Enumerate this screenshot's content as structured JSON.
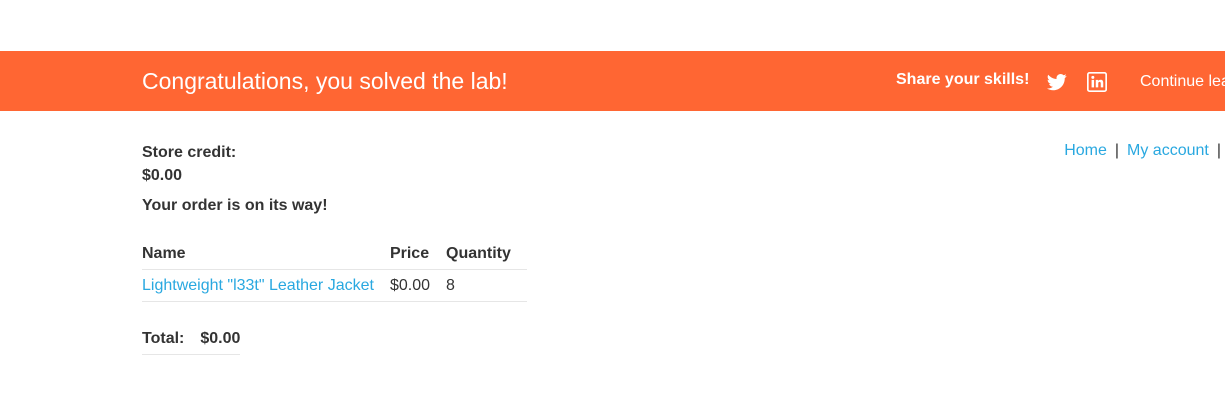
{
  "banner": {
    "title": "Congratulations, you solved the lab!",
    "share_label": "Share your skills!",
    "twitter_icon": "twitter-icon",
    "linkedin_icon": "linkedin-icon",
    "continue_label": "Continue learning",
    "background_color": "#ff6633"
  },
  "account": {
    "store_credit_label": "Store credit:",
    "store_credit_value": "$0.00"
  },
  "nav": {
    "home": "Home",
    "separator": "|",
    "my_account": "My account"
  },
  "order": {
    "message": "Your order is on its way!",
    "columns": [
      "Name",
      "Price",
      "Quantity"
    ],
    "rows": [
      {
        "name": "Lightweight \"l33t\" Leather Jacket",
        "price": "$0.00",
        "quantity": "8"
      }
    ],
    "total_label": "Total:",
    "total_value": "$0.00"
  },
  "link_color": "#29a8e0"
}
